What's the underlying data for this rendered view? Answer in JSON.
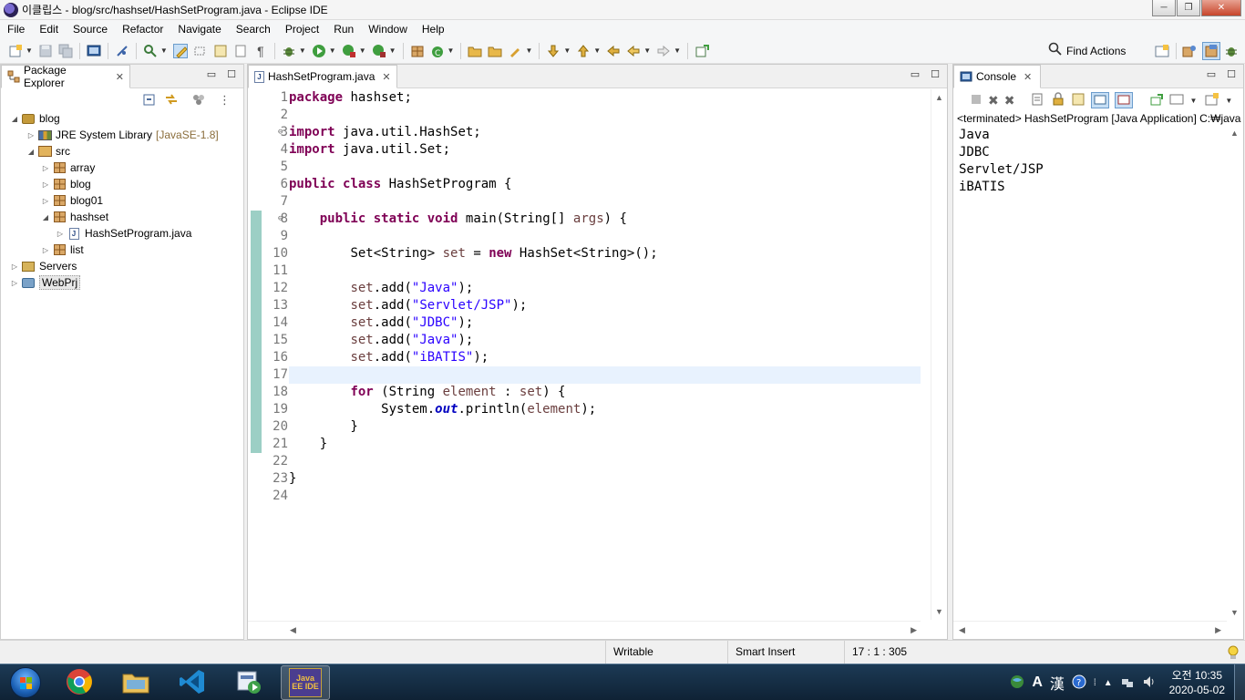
{
  "window": {
    "title": "이클립스 - blog/src/hashset/HashSetProgram.java - Eclipse IDE",
    "minimize": "─",
    "restore": "❐",
    "close": "✕"
  },
  "menu": [
    "File",
    "Edit",
    "Source",
    "Refactor",
    "Navigate",
    "Search",
    "Project",
    "Run",
    "Window",
    "Help"
  ],
  "toolbar": {
    "find_actions": "Find Actions"
  },
  "package_explorer": {
    "tab_label": "Package Explorer",
    "tree": [
      {
        "label": "blog",
        "level": 0,
        "icon": "project-icon",
        "expanded": true
      },
      {
        "label": "JRE System Library",
        "suffix": "[JavaSE-1.8]",
        "level": 1,
        "icon": "library-icon",
        "expanded": false
      },
      {
        "label": "src",
        "level": 1,
        "icon": "source-folder-icon",
        "expanded": true
      },
      {
        "label": "array",
        "level": 2,
        "icon": "package-icon",
        "expanded": false
      },
      {
        "label": "blog",
        "level": 2,
        "icon": "package-icon",
        "expanded": false
      },
      {
        "label": "blog01",
        "level": 2,
        "icon": "package-icon",
        "expanded": false
      },
      {
        "label": "hashset",
        "level": 2,
        "icon": "package-icon",
        "expanded": true
      },
      {
        "label": "HashSetProgram.java",
        "level": 3,
        "icon": "java-file-icon",
        "expanded": false
      },
      {
        "label": "list",
        "level": 2,
        "icon": "package-icon",
        "expanded": false
      },
      {
        "label": "Servers",
        "level": 0,
        "icon": "server-icon",
        "expanded": false
      },
      {
        "label": "WebPrj",
        "level": 0,
        "icon": "project-icon",
        "expanded": false
      }
    ]
  },
  "editor": {
    "tab_label": "HashSetProgram.java",
    "lines": [
      "package hashset;",
      "",
      "import java.util.HashSet;",
      "import java.util.Set;",
      "",
      "public class HashSetProgram {",
      "",
      "    public static void main(String[] args) {",
      "",
      "        Set<String> set = new HashSet<String>();",
      "",
      "        set.add(\"Java\");",
      "        set.add(\"Servlet/JSP\");",
      "        set.add(\"JDBC\");",
      "        set.add(\"Java\");",
      "        set.add(\"iBATIS\");",
      "",
      "        for (String element : set) {",
      "            System.out.println(element);",
      "        }",
      "    }",
      "",
      "}",
      ""
    ],
    "current_line": 17
  },
  "console": {
    "tab_label": "Console",
    "status": "<terminated> HashSetProgram [Java Application] C:₩java",
    "output": [
      "Java",
      "JDBC",
      "Servlet/JSP",
      "iBATIS"
    ]
  },
  "statusbar": {
    "writable": "Writable",
    "insert_mode": "Smart Insert",
    "position": "17 : 1 : 305"
  },
  "taskbar": {
    "clock_time": "오전 10:35",
    "clock_date": "2020-05-02",
    "ime_a": "A",
    "ime_han": "漢",
    "eclipse_label": "Java EE IDE"
  },
  "colors": {
    "keyword": "#7f0055",
    "string": "#2a00ff",
    "local_var": "#6a3e3e",
    "static_field": "#0000c0",
    "current_line": "#e8f2fe"
  }
}
